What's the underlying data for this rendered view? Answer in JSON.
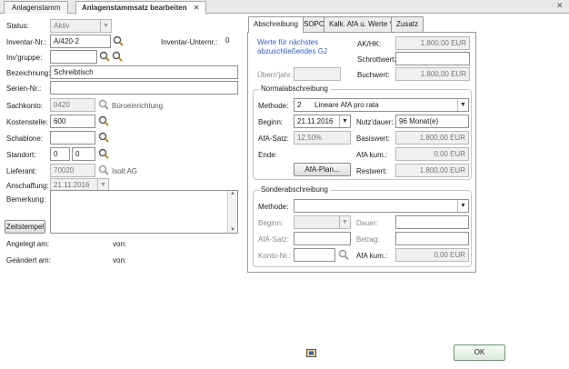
{
  "tabs": [
    {
      "label": "Anlagenstamm"
    },
    {
      "label": "Anlagenstammsatz bearbeiten"
    }
  ],
  "left": {
    "status": {
      "label": "Status:",
      "value": "Aktiv"
    },
    "inventar_nr": {
      "label": "Inventar-Nr.:",
      "value": "A/420-2"
    },
    "inventar_unternr": {
      "label": "Inventar-Unternr.:",
      "value": "0"
    },
    "inv_gruppe": {
      "label": "Inv'gruppe:",
      "value": ""
    },
    "bezeichnung": {
      "label": "Bezeichnung:",
      "value": "Schreibtisch"
    },
    "serien_nr": {
      "label": "Serien-Nr.:",
      "value": ""
    },
    "sachkonto": {
      "label": "Sachkonto:",
      "value": "0420",
      "desc": "Büroeinrichtung"
    },
    "kostenstelle": {
      "label": "Kostenstelle:",
      "value": "600"
    },
    "schablone": {
      "label": "Schablone:",
      "value": ""
    },
    "standort": {
      "label": "Standort:",
      "value1": "0",
      "value2": "0"
    },
    "lieferant": {
      "label": "Lieferant:",
      "value": "70020",
      "desc": "Isolt AG"
    },
    "anschaffung": {
      "label": "Anschaffung:",
      "value": "21.11.2016"
    },
    "bemerkung": {
      "label": "Bemerkung:",
      "value": ""
    },
    "zeitstempel_button": "Zeitstempel",
    "angelegt_label": "Angelegt am:",
    "angelegt_von": "von:",
    "geaendert_label": "Geändert am:",
    "geaendert_von": "von:"
  },
  "right_tabs": [
    {
      "label": "Abschreibung"
    },
    {
      "label": "SOPO"
    },
    {
      "label": "Kalk. AfA u. Werte *"
    },
    {
      "label": "Zusatz"
    }
  ],
  "werte": {
    "info_text": "Werte für nächstes abzuschließendes GJ",
    "ak_hk_label": "AK/HK:",
    "ak_hk_value": "1.800,00 EUR",
    "schrottwert_label": "Schrottwert:",
    "schrottwert_value": "",
    "uebernjahr_label": "Übern'jahr:",
    "buchwert_label": "Buchwert:",
    "buchwert_value": "1.800,00 EUR"
  },
  "normal": {
    "title": "Normalabschreibung",
    "methode_label": "Methode:",
    "methode_code": "2",
    "methode_value": "Lineare AfA pro rata",
    "beginn_label": "Beginn:",
    "beginn_value": "21.11.2016",
    "nutzdauer_label": "Nutz'dauer:",
    "nutzdauer_value": "96 Monat(e)",
    "afa_satz_label": "AfA-Satz:",
    "afa_satz_value": "12,50%",
    "basiswert_label": "Basiswert:",
    "basiswert_value": "1.800,00 EUR",
    "afa_kum_label": "AfA kum.:",
    "afa_kum_value": "0,00 EUR",
    "ende_label": "Ende:",
    "afa_plan_button": "AfA-Plan...",
    "restwert_label": "Restwert:",
    "restwert_value": "1.800,00 EUR"
  },
  "sonder": {
    "title": "Sonderabschreibung",
    "methode_label": "Methode:",
    "methode_value": "",
    "beginn_label": "Beginn:",
    "dauer_label": "Dauer:",
    "afa_satz_label": "AfA-Satz:",
    "betrag_label": "Betrag:",
    "konto_nr_label": "Konto-Nr.:",
    "afa_kum_label": "AfA kum.:",
    "afa_kum_value": "0,00 EUR"
  },
  "ok_button": "OK"
}
